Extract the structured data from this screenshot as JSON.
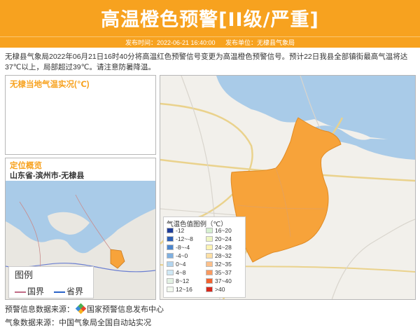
{
  "header": {
    "title": "高温橙色预警[II级/严重]",
    "publish_time": "发布时间：2022-06-21 16:40:00",
    "publisher": "发布单位：无棣县气象局"
  },
  "description": "无棣县气象局2022年06月21日16时40分将高温红色预警信号变更为高温橙色预警信号。预计22日我县全部镇街最高气温将达37℃以上，局部超过39℃。请注意防暑降温。",
  "temp_panel": {
    "title": "无棣当地气温实况(℃)"
  },
  "location_panel": {
    "title": "定位概览",
    "location": "山东省-滨州市-无棣县",
    "legend": {
      "title": "图例",
      "national_border": "国界",
      "province_border": "省界"
    }
  },
  "temp_legend": {
    "title": "气温色值图例（℃）",
    "items": [
      {
        "label": "-12",
        "color": "#1f3d99"
      },
      {
        "label": "16~20",
        "color": "#d6f0d0"
      },
      {
        "label": "-12~-8",
        "color": "#2e5fb3"
      },
      {
        "label": "20~24",
        "color": "#eef6c2"
      },
      {
        "label": "-8~-4",
        "color": "#4c86cc"
      },
      {
        "label": "24~28",
        "color": "#fdf4b3"
      },
      {
        "label": "-4~0",
        "color": "#7fb0e0"
      },
      {
        "label": "28~32",
        "color": "#fde0a5"
      },
      {
        "label": "0~4",
        "color": "#b2d5ef"
      },
      {
        "label": "32~35",
        "color": "#fcc08a"
      },
      {
        "label": "4~8",
        "color": "#cfe8f5"
      },
      {
        "label": "35~37",
        "color": "#f99a61"
      },
      {
        "label": "8~12",
        "color": "#e3f2e3"
      },
      {
        "label": "37~40",
        "color": "#f2622e"
      },
      {
        "label": "12~16",
        "color": "#f2f9ee"
      },
      {
        "label": ">40",
        "color": "#d8291c"
      }
    ]
  },
  "footer": {
    "warning_source_label": "预警信息数据来源：",
    "warning_source": "国家预警信息发布中心",
    "weather_source": "气象数据来源：中国气象局全国自动站实况"
  },
  "colors": {
    "accent": "#f7a21f",
    "warning_area": "#f7a33a",
    "sea": "#a9cbe8"
  }
}
